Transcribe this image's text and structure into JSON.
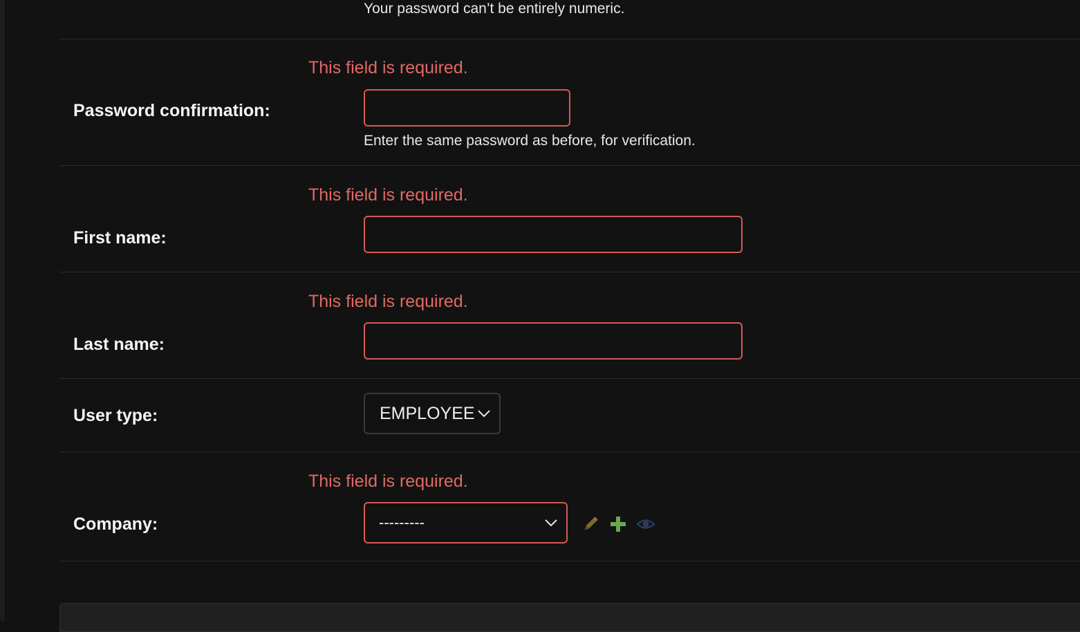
{
  "password_hint_tail": "Your password can’t be entirely numeric.",
  "fields": {
    "password_confirmation": {
      "label": "Password confirmation:",
      "error": "This field is required.",
      "value": "",
      "help": "Enter the same password as before, for verification."
    },
    "first_name": {
      "label": "First name:",
      "error": "This field is required.",
      "value": ""
    },
    "last_name": {
      "label": "Last name:",
      "error": "This field is required.",
      "value": ""
    },
    "user_type": {
      "label": "User type:",
      "selected": "EMPLOYEE"
    },
    "company": {
      "label": "Company:",
      "error": "This field is required.",
      "selected": "---------",
      "actions": {
        "change_icon": "pencil-icon",
        "add_icon": "plus-icon",
        "view_icon": "eye-icon"
      }
    }
  },
  "colors": {
    "background": "#121212",
    "error": "#e06a63",
    "error_border": "#d65a55",
    "add_green": "#6aa84f",
    "pencil": "#7a6a2e",
    "eye": "#2c3a5a"
  }
}
